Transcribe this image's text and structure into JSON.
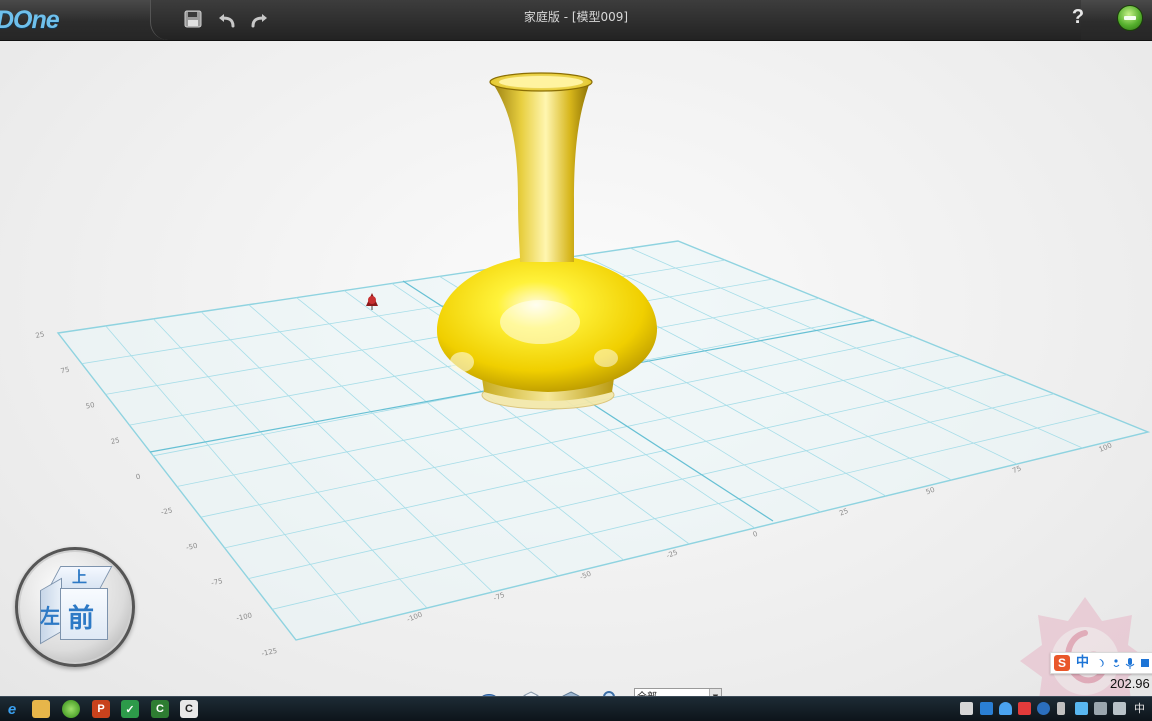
{
  "app": {
    "logo_text": "DOne",
    "window_title": "家庭版 - [模型009]",
    "help_label": "?"
  },
  "toolbar": {
    "icons": [
      "save-icon",
      "undo-icon",
      "redo-icon"
    ]
  },
  "viewport": {
    "grid_left_ticks": [
      "25",
      "75",
      "50",
      "25",
      "0",
      "-25",
      "-50",
      "-75",
      "-100",
      "-125"
    ],
    "grid_front_ticks": [
      "-100",
      "-75",
      "-50",
      "-25",
      "0",
      "25",
      "50",
      "75",
      "100"
    ],
    "model_color": "#f2d20a",
    "grid_color": "#8fd3e0"
  },
  "view_cube": {
    "top_label": "上",
    "left_label": "左",
    "front_label": "前"
  },
  "bottom_toolbar": {
    "icons": [
      "eye-icon",
      "cube-outline-icon",
      "solid-cube-icon",
      "zoom-icon"
    ],
    "view_select_value": "全部"
  },
  "ime": {
    "logo": "S",
    "lang": "中",
    "counter_text": "202.96"
  },
  "taskbar": {
    "tray_ime_label": "中",
    "app_icons": [
      "ie-icon",
      "folder-icon",
      "browser-icon",
      "powerpoint-icon",
      "app-green-icon",
      "camtasia-icon",
      "app-c-icon"
    ]
  }
}
